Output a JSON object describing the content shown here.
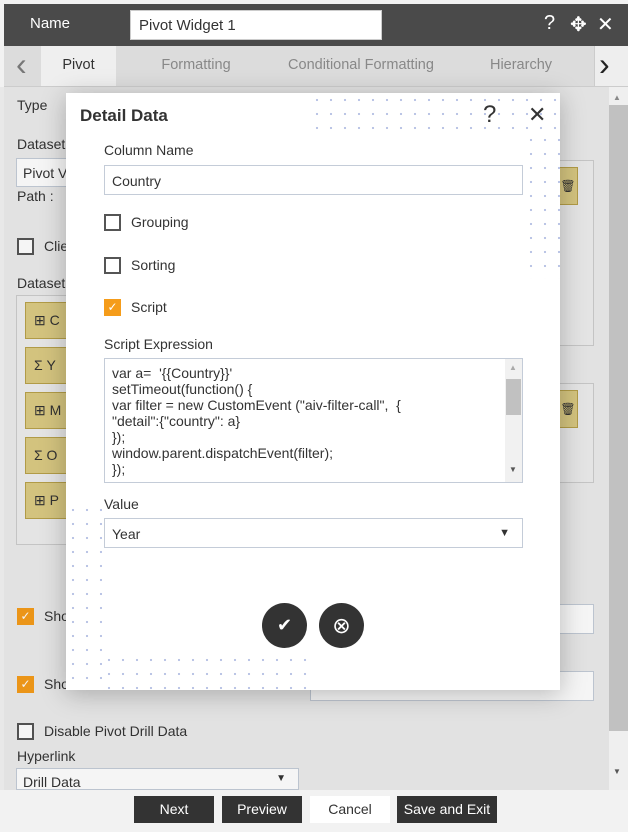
{
  "header": {
    "name_label": "Name",
    "widget_name": "Pivot Widget 1",
    "help_icon": "?",
    "move_icon": "✥",
    "close_icon": "✕"
  },
  "tabs": [
    {
      "label": "Pivot",
      "active": true
    },
    {
      "label": "Formatting"
    },
    {
      "label": "Conditional Formatting"
    },
    {
      "label": "Hierarchy"
    }
  ],
  "nav": {
    "prev": "‹",
    "next": "›"
  },
  "form": {
    "type_label": "Type",
    "dataset_label": "Dataset",
    "dataset_value": "Pivot V",
    "path_label": "Path :",
    "client_label": "Clie",
    "dataset_fields_label": "Dataset",
    "dataset_items": [
      {
        "icon": "table-icon",
        "glyph": "⊞",
        "label": "C"
      },
      {
        "icon": "sigma-icon",
        "glyph": "Σ",
        "label": "Y"
      },
      {
        "icon": "table-icon",
        "glyph": "⊞",
        "label": "M"
      },
      {
        "icon": "sigma-icon",
        "glyph": "Σ",
        "label": "O"
      },
      {
        "icon": "table-icon",
        "glyph": "⊞",
        "label": "P"
      }
    ],
    "show1_label": "Sho",
    "show1_checked": true,
    "show2_label": "Sho",
    "show2_checked": true,
    "disable_drill_label": "Disable Pivot Drill Data",
    "disable_drill_checked": false,
    "hyperlink_label": "Hyperlink",
    "hyperlink_value": "Drill Data"
  },
  "modal": {
    "title": "Detail Data",
    "column_name_label": "Column Name",
    "column_name_value": "Country",
    "grouping_label": "Grouping",
    "grouping_checked": false,
    "sorting_label": "Sorting",
    "sorting_checked": false,
    "script_label": "Script",
    "script_checked": true,
    "script_expression_label": "Script Expression",
    "script": "var a=  '{{Country}}'\nsetTimeout(function() {\nvar filter = new CustomEvent (\"aiv-filter-call\",  {\n\"detail\":{\"country\": a}\n});\nwindow.parent.dispatchEvent(filter);\n});",
    "value_label": "Value",
    "value_selected": "Year",
    "ok_icon": "✔",
    "cancel_icon": "⊗"
  },
  "footer": {
    "next": "Next",
    "preview": "Preview",
    "cancel": "Cancel",
    "save_exit": "Save and Exit"
  },
  "colors": {
    "header_bg": "#4a4a4a",
    "accent_checkbox": "#f59c1a",
    "dataset_item": "#dccb84",
    "button_dark": "#333333"
  }
}
